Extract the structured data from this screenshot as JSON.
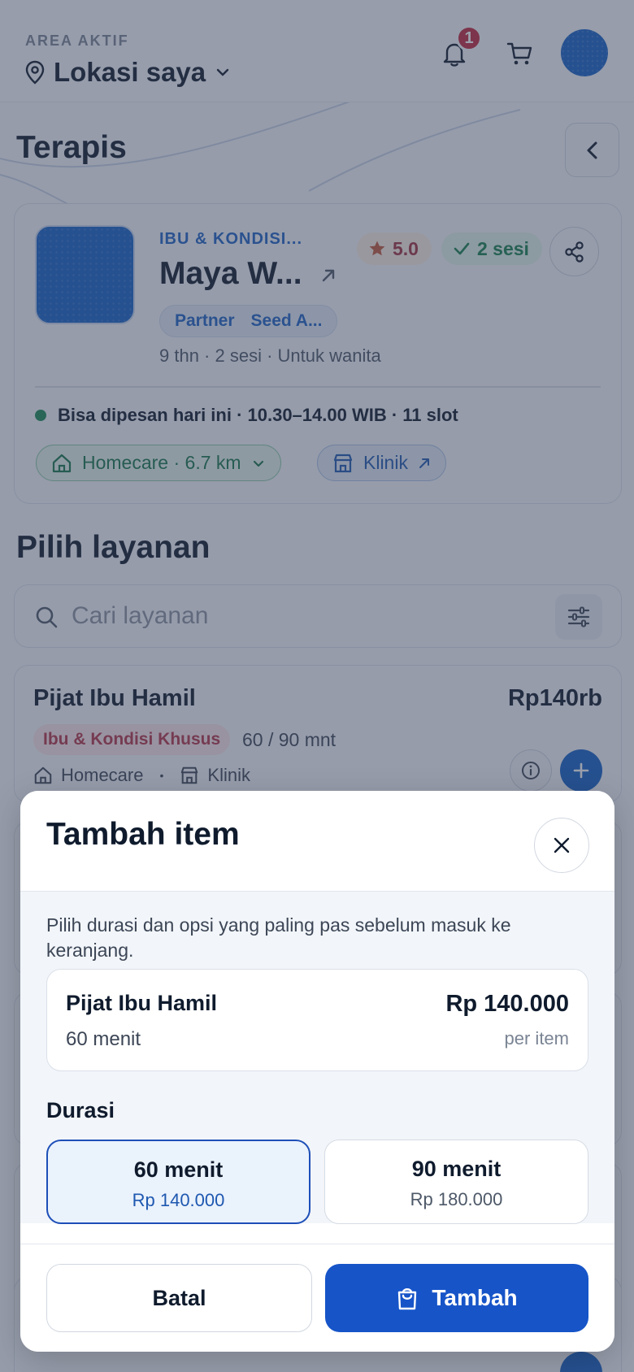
{
  "header": {
    "area_label": "AREA AKTIF",
    "location": "Lokasi saya",
    "notification_count": "1"
  },
  "therapist_section": {
    "title": "Terapis"
  },
  "therapist": {
    "category": "IBU & KONDISI...",
    "name": "Maya W...",
    "rating": "5.0",
    "sessions_badge": "2 sesi",
    "tags": [
      "Partner",
      "Seed A..."
    ],
    "meta": "9 thn · 2 sesi · Untuk wanita",
    "availability": "Bisa dipesan hari ini · 10.30–14.00 WIB · 11 slot",
    "homecare_chip": "Homecare · 6.7 km",
    "clinic_chip": "Klinik"
  },
  "services_section": {
    "title": "Pilih layanan",
    "search_placeholder": "Cari layanan"
  },
  "services": [
    {
      "name": "Pijat Ibu Hamil",
      "price": "Rp140rb",
      "category": "Ibu & Kondisi Khusus",
      "duration": "60 / 90 mnt",
      "mode_homecare": "Homecare",
      "mode_separator": "•",
      "mode_clinic": "Klinik"
    }
  ],
  "modal": {
    "title": "Tambah item",
    "description": "Pilih durasi dan opsi yang paling pas sebelum masuk ke keranjang.",
    "summary": {
      "name": "Pijat Ibu Hamil",
      "duration": "60 menit",
      "price": "Rp 140.000",
      "unit": "per item"
    },
    "duration_label": "Durasi",
    "options": [
      {
        "title": "60 menit",
        "price": "Rp 140.000",
        "selected": true
      },
      {
        "title": "90 menit",
        "price": "Rp 180.000",
        "selected": false
      }
    ],
    "cancel_label": "Batal",
    "add_label": "Tambah"
  },
  "colors": {
    "primary": "#1654c8",
    "accent_blue": "#1460c6",
    "success": "#1a8a55",
    "danger": "#c0283f"
  }
}
